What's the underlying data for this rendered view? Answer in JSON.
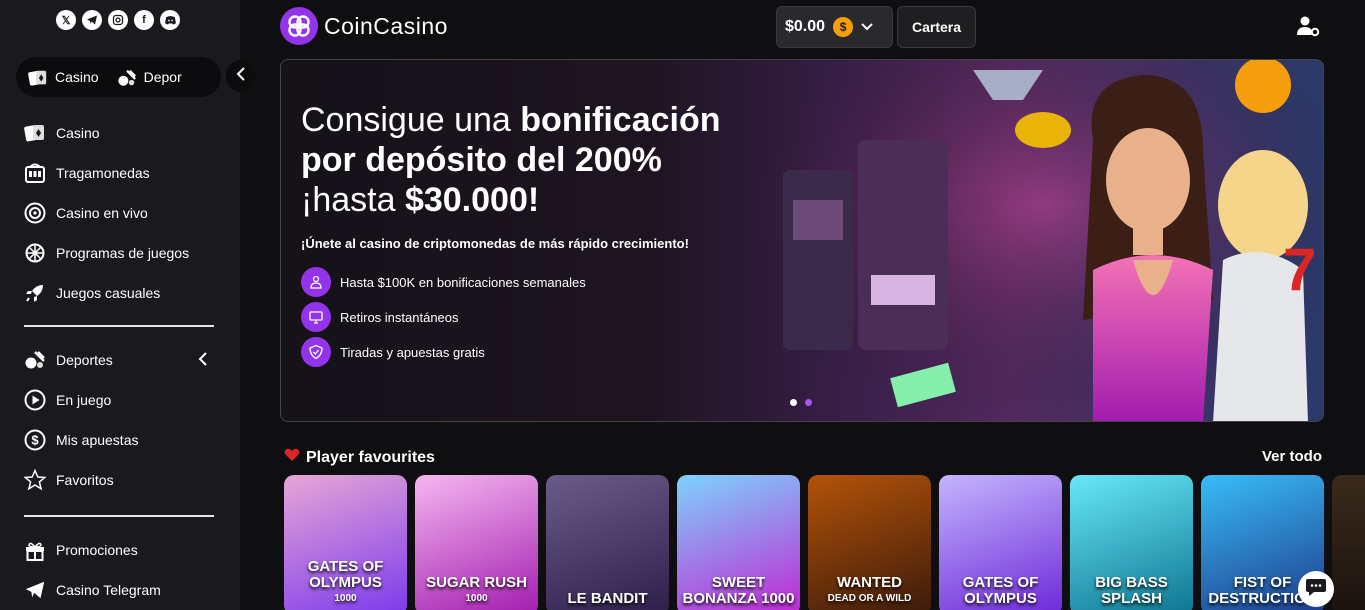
{
  "sidebar": {
    "socials": [
      "X",
      "Telegram",
      "Instagram",
      "Facebook",
      "Discord"
    ],
    "switcher": [
      {
        "label": "Casino",
        "icon": "cards-icon"
      },
      {
        "label": "Depor",
        "icon": "sports-icon"
      }
    ],
    "casino_items": [
      {
        "label": "Casino",
        "icon": "cards-icon"
      },
      {
        "label": "Tragamonedas",
        "icon": "slot-machine-icon"
      },
      {
        "label": "Casino en vivo",
        "icon": "roulette-icon"
      },
      {
        "label": "Programas de juegos",
        "icon": "wheel-icon"
      },
      {
        "label": "Juegos casuales",
        "icon": "rocket-icon"
      }
    ],
    "sports_items": [
      {
        "label": "Deportes",
        "icon": "sports-icon"
      },
      {
        "label": "En juego",
        "icon": "play-icon"
      },
      {
        "label": "Mis apuestas",
        "icon": "dollar-coin-icon"
      },
      {
        "label": "Favoritos",
        "icon": "star-icon"
      }
    ],
    "extra_items": [
      {
        "label": "Promociones",
        "icon": "gift-icon"
      },
      {
        "label": "Casino Telegram",
        "icon": "telegram-icon"
      }
    ]
  },
  "header": {
    "logo_text": "CoinCasino",
    "balance": "$0.00",
    "currency_symbol": "$",
    "wallet_label": "Cartera"
  },
  "banner": {
    "title_part1": "Consigue una ",
    "title_bold1": "bonificación por depósito del 200%",
    "title_part2": " ¡hasta ",
    "title_bold2": "$30.000!",
    "subtitle": "¡Únete al casino de criptomonedas de más rápido crecimiento!",
    "features": [
      "Hasta $100K en bonificaciones semanales",
      "Retiros instantáneos",
      "Tiradas y apuestas gratis"
    ],
    "slides": 2,
    "active_slide": 2
  },
  "favourites": {
    "title": "Player favourites",
    "see_all": "Ver todo",
    "games": [
      {
        "name": "Gates of Olympus",
        "sub": "1000",
        "color1": "#e7a6d6",
        "color2": "#7c3aed"
      },
      {
        "name": "Sugar Rush",
        "sub": "1000",
        "color1": "#f5b6f0",
        "color2": "#a21caf"
      },
      {
        "name": "Le Bandit",
        "sub": "",
        "color1": "#6b5b8a",
        "color2": "#2d1f4a"
      },
      {
        "name": "Sweet Bonanza 1000",
        "sub": "",
        "color1": "#7dd3fc",
        "color2": "#c026d3"
      },
      {
        "name": "Wanted",
        "sub": "Dead or a Wild",
        "color1": "#b45309",
        "color2": "#3b1a0a"
      },
      {
        "name": "Gates of Olympus",
        "sub": "",
        "color1": "#c4b5fd",
        "color2": "#6d28d9"
      },
      {
        "name": "Big Bass Splash",
        "sub": "",
        "color1": "#67e8f9",
        "color2": "#0e7490"
      },
      {
        "name": "Fist of Destruction",
        "sub": "",
        "color1": "#38bdf8",
        "color2": "#1e3a8a"
      }
    ]
  }
}
